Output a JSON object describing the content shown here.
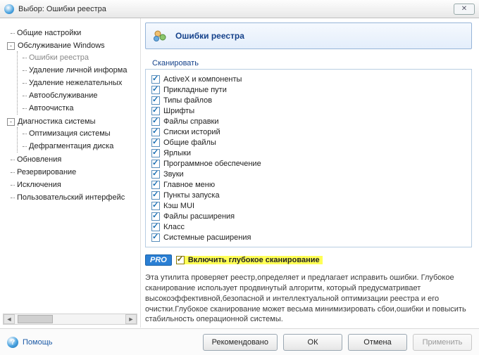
{
  "window": {
    "title": "Выбор: Ошибки реестра",
    "close_glyph": "✕"
  },
  "tree": {
    "items": [
      {
        "label": "Общие настройки",
        "level": 0,
        "toggle": ""
      },
      {
        "label": "Обслуживание Windows",
        "level": 0,
        "toggle": "-"
      },
      {
        "label": "Ошибки реестра",
        "level": 1,
        "toggle": "",
        "selected": true
      },
      {
        "label": "Удаление личной информа",
        "level": 1,
        "toggle": ""
      },
      {
        "label": "Удаление нежелательных",
        "level": 1,
        "toggle": ""
      },
      {
        "label": "Автообслуживание",
        "level": 1,
        "toggle": ""
      },
      {
        "label": "Автоочистка",
        "level": 1,
        "toggle": ""
      },
      {
        "label": "Диагностика системы",
        "level": 0,
        "toggle": "-"
      },
      {
        "label": "Оптимизация системы",
        "level": 1,
        "toggle": ""
      },
      {
        "label": "Дефрагментация диска",
        "level": 1,
        "toggle": ""
      },
      {
        "label": "Обновления",
        "level": 0,
        "toggle": ""
      },
      {
        "label": "Резервирование",
        "level": 0,
        "toggle": ""
      },
      {
        "label": "Исключения",
        "level": 0,
        "toggle": ""
      },
      {
        "label": "Пользовательский интерфейс",
        "level": 0,
        "toggle": ""
      }
    ]
  },
  "panel": {
    "title": "Ошибки реестра"
  },
  "scan": {
    "legend": "Сканировать",
    "items": [
      {
        "label": "ActiveX и компоненты",
        "checked": true
      },
      {
        "label": "Прикладные пути",
        "checked": true
      },
      {
        "label": "Типы файлов",
        "checked": true
      },
      {
        "label": "Шрифты",
        "checked": true
      },
      {
        "label": "Файлы справки",
        "checked": true
      },
      {
        "label": "Списки историй",
        "checked": true
      },
      {
        "label": "Общие файлы",
        "checked": true
      },
      {
        "label": "Ярлыки",
        "checked": true
      },
      {
        "label": "Программное обеспечение",
        "checked": true
      },
      {
        "label": "Звуки",
        "checked": true
      },
      {
        "label": "Главное меню",
        "checked": true
      },
      {
        "label": "Пункты запуска",
        "checked": true
      },
      {
        "label": "Кэш MUI",
        "checked": true
      },
      {
        "label": "Файлы расширения",
        "checked": true
      },
      {
        "label": "Класс",
        "checked": true
      },
      {
        "label": "Системные расширения",
        "checked": true
      }
    ]
  },
  "pro": {
    "badge": "PRO",
    "deep_label": "Включить глубокое сканирование",
    "deep_checked": true
  },
  "description": "Эта утилита проверяет реестр,определяет и предлагает исправить ошибки. Глубокое сканирование использует продвинутый алгоритм, который предусматривает высокоэффективной,безопасной и интеллектуальной оптимизации реестра и его очистки.Глубокое сканирование может весьма минимизировать сбои,ошибки и повысить стабильность операционной системы.",
  "footer": {
    "help": "Помощь",
    "recommended": "Рекомендовано",
    "ok": "ОК",
    "cancel": "Отмена",
    "apply": "Применить"
  }
}
